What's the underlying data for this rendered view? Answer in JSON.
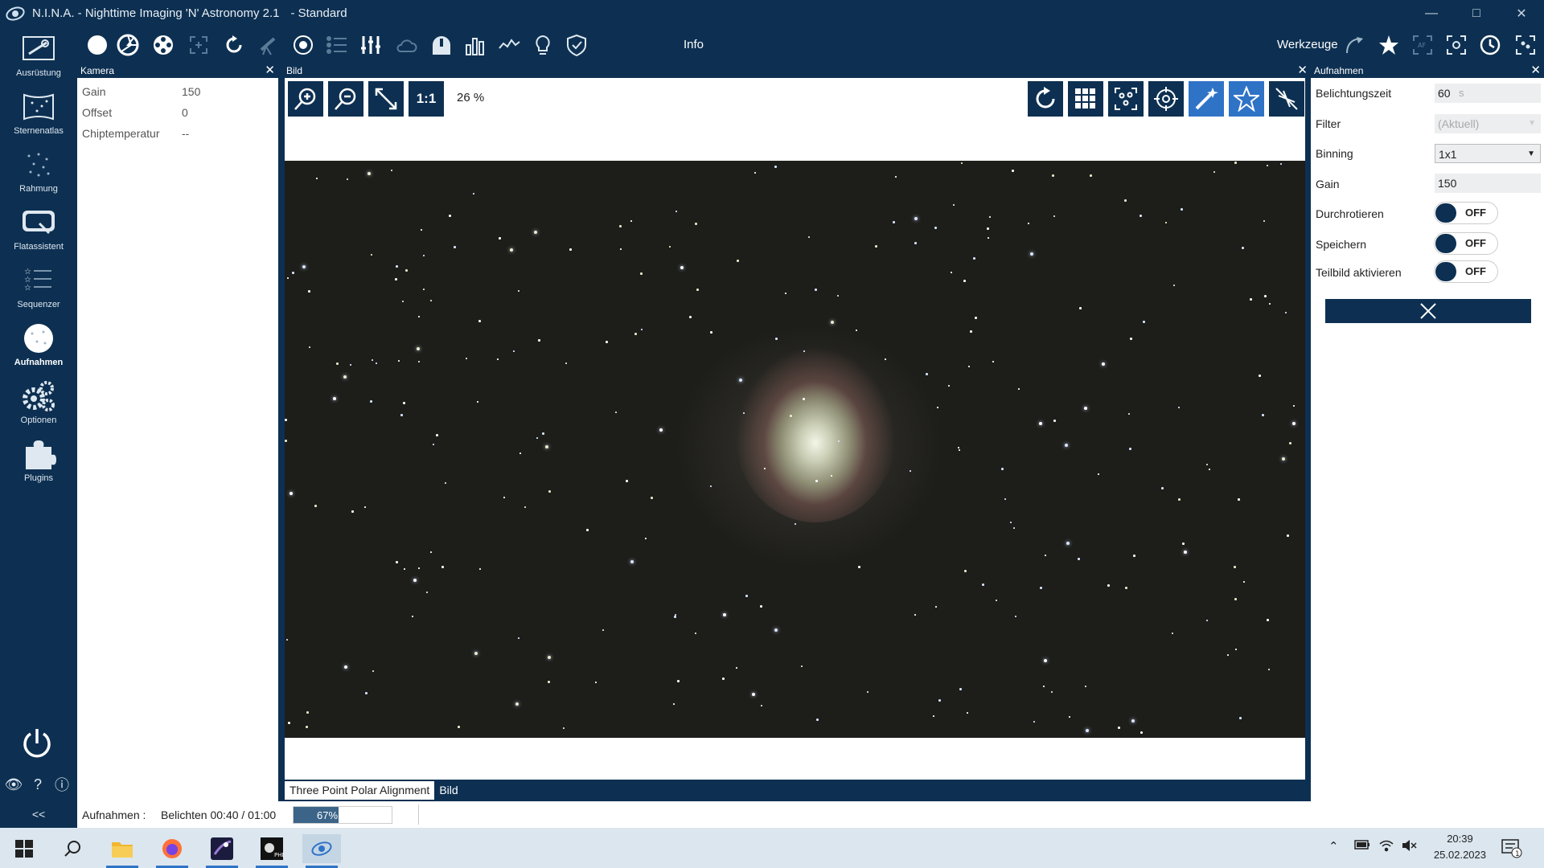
{
  "window": {
    "title": "N.I.N.A. - Nighttime Imaging 'N' Astronomy 2.1",
    "profile": "-  Standard"
  },
  "nav": {
    "items": [
      {
        "label": "Ausrüstung",
        "icon": "equipment-icon"
      },
      {
        "label": "Sternenatlas",
        "icon": "sky-atlas-icon"
      },
      {
        "label": "Rahmung",
        "icon": "framing-icon"
      },
      {
        "label": "Flatassistent",
        "icon": "flat-wizard-icon"
      },
      {
        "label": "Sequenzer",
        "icon": "sequencer-icon"
      },
      {
        "label": "Aufnahmen",
        "icon": "imaging-icon",
        "active": true
      },
      {
        "label": "Optionen",
        "icon": "options-icon"
      },
      {
        "label": "Plugins",
        "icon": "plugins-icon"
      }
    ],
    "collapse_label": "<<"
  },
  "toolbar": {
    "info_label": "Info",
    "tools_label": "Werkzeuge"
  },
  "camera_panel": {
    "title": "Kamera",
    "rows": [
      {
        "label": "Gain",
        "value": "150"
      },
      {
        "label": "Offset",
        "value": "0"
      },
      {
        "label": "Chiptemperatur",
        "value": "--"
      }
    ]
  },
  "image_panel": {
    "title": "Bild",
    "one_to_one": "1:1",
    "zoom": "26 %",
    "tabs": [
      "Three Point Polar Alignment",
      "Bild"
    ],
    "active_tab": "Bild"
  },
  "capture_panel": {
    "title": "Aufnahmen",
    "exposure_label": "Belichtungszeit",
    "exposure_value": "60",
    "exposure_unit": "s",
    "filter_label": "Filter",
    "filter_value": "(Aktuell)",
    "binning_label": "Binning",
    "binning_value": "1x1",
    "gain_label": "Gain",
    "gain_value": "150",
    "dither_label": "Durchrotieren",
    "dither_state": "OFF",
    "save_label": "Speichern",
    "save_state": "OFF",
    "subframe_label": "Teilbild aktivieren",
    "subframe_state": "OFF"
  },
  "status": {
    "label": "Aufnahmen :",
    "text": "Belichten 00:40 / 01:00",
    "progress": 0.67,
    "progress_text": "67%"
  },
  "taskbar": {
    "time": "20:39",
    "date": "25.02.2023",
    "notifications": "1"
  },
  "colors": {
    "navy": "#0d3052",
    "accent_blue": "#2f73c7",
    "progress_fill": "#3b6488"
  }
}
